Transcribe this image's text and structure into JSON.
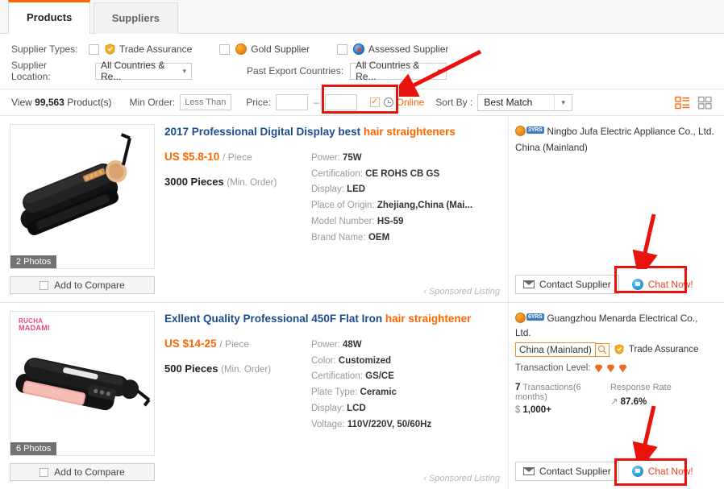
{
  "tabs": [
    {
      "label": "Products",
      "active": true
    },
    {
      "label": "Suppliers",
      "active": false
    }
  ],
  "filters": {
    "supplier_types_label": "Supplier Types:",
    "types": [
      {
        "label": "Trade Assurance",
        "icon": "trade-assurance-icon",
        "checked": false
      },
      {
        "label": "Gold Supplier",
        "icon": "gold-supplier-icon",
        "checked": false
      },
      {
        "label": "Assessed Supplier",
        "icon": "assessed-supplier-icon",
        "checked": false
      }
    ],
    "supplier_location_label": "Supplier Location:",
    "supplier_location_value": "All Countries & Re...",
    "past_export_label": "Past Export Countries:",
    "past_export_value": "All Countries & Re..."
  },
  "sortbar": {
    "view_prefix": "View",
    "view_count": "99,563",
    "view_suffix": "Product(s)",
    "min_order_label": "Min Order:",
    "min_order_placeholder": "Less Than",
    "min_order_value": "",
    "price_label": "Price:",
    "price_min": "",
    "price_max": "",
    "price_dash": "–",
    "online_label": "Online",
    "online_checked": true,
    "sort_by_label": "Sort By :",
    "sort_by_value": "Best Match",
    "view_list_icon": "list-view-icon",
    "view_grid_icon": "grid-view-icon"
  },
  "products": [
    {
      "title_main": "2017 Professional Digital Display best ",
      "title_highlight": "hair straighteners",
      "photos_badge": "2 Photos",
      "compare_label": "Add to Compare",
      "price": "US $5.8-10",
      "price_unit": "/ Piece",
      "moq": "3000 Pieces",
      "moq_sub": "(Min. Order)",
      "attrs": [
        {
          "k": "Power:",
          "v": "75W"
        },
        {
          "k": "Certification:",
          "v": "CE ROHS CB GS"
        },
        {
          "k": "Display:",
          "v": "LED"
        },
        {
          "k": "Place of Origin:",
          "v": "Zhejiang,China (Mai..."
        },
        {
          "k": "Model Number:",
          "v": "HS-59"
        },
        {
          "k": "Brand Name:",
          "v": "OEM"
        }
      ],
      "sponsored": "Sponsored Listing",
      "supplier_name": "Ningbo Jufa Electric Appliance Co., Ltd.",
      "supplier_years": "3YRS",
      "supplier_location": "China (Mainland)",
      "location_highlighted": false,
      "trade_assurance": "",
      "transaction_level_label": "",
      "transaction_level": 0,
      "transactions_label": "",
      "transactions_count": "",
      "transactions_value": "",
      "response_rate_label": "",
      "response_rate_value": "",
      "contact_label": "Contact Supplier",
      "chat_label": "Chat Now!",
      "brandmark": ""
    },
    {
      "title_main": "Exllent Quality Professional 450F Flat Iron ",
      "title_highlight": "hair straightener",
      "photos_badge": "6 Photos",
      "compare_label": "Add to Compare",
      "price": "US $14-25",
      "price_unit": "/ Piece",
      "moq": "500 Pieces",
      "moq_sub": "(Min. Order)",
      "attrs": [
        {
          "k": "Power:",
          "v": "48W"
        },
        {
          "k": "Color:",
          "v": "Customized"
        },
        {
          "k": "Certification:",
          "v": "GS/CE"
        },
        {
          "k": "Plate Type:",
          "v": "Ceramic"
        },
        {
          "k": "Display:",
          "v": "LCD"
        },
        {
          "k": "Voltage:",
          "v": "110V/220V, 50/60Hz"
        }
      ],
      "sponsored": "Sponsored Listing",
      "supplier_name": "Guangzhou Menarda Electrical Co., Ltd.",
      "supplier_years": "6YRS",
      "supplier_location": "China (Mainland)",
      "location_highlighted": true,
      "trade_assurance": "Trade Assurance",
      "transaction_level_label": "Transaction Level:",
      "transaction_level": 3,
      "transactions_count": "7",
      "transactions_label": "Transactions(6 months)",
      "transactions_value": "1,000+",
      "response_rate_label": "Response Rate",
      "response_rate_value": "87.6%",
      "contact_label": "Contact Supplier",
      "chat_label": "Chat Now!",
      "brandmark": "RUCHA MADAMI"
    }
  ],
  "colors": {
    "accent": "#f60",
    "link": "#1a4d8f",
    "annotation": "#e8130c",
    "chat": "#e8431f"
  }
}
